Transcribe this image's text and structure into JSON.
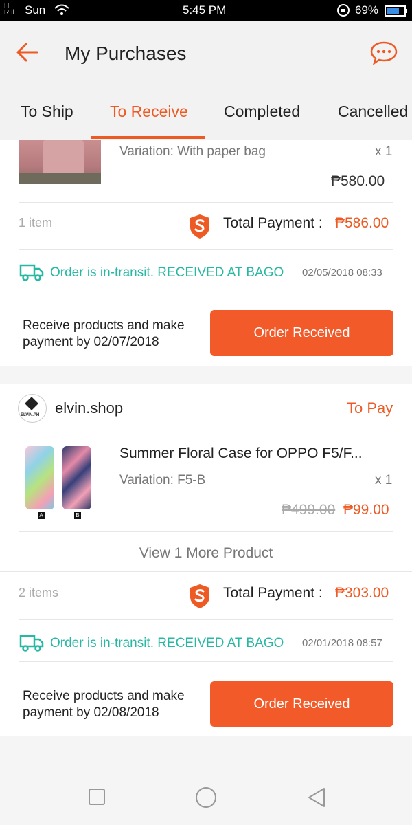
{
  "status_bar": {
    "carrier": "Sun",
    "time": "5:45 PM",
    "battery": "69%"
  },
  "header": {
    "title": "My Purchases",
    "tabs": [
      {
        "label": "To Ship"
      },
      {
        "label": "To Receive"
      },
      {
        "label": "Completed"
      },
      {
        "label": "Cancelled"
      }
    ],
    "active_tab": "To Receive"
  },
  "order1": {
    "variation": "Variation: With paper bag",
    "qty": "x 1",
    "price": "₱580.00",
    "items_count": "1 item",
    "total_label": "Total Payment :",
    "total_value": "₱586.00",
    "status_text": "Order is in-transit. RECEIVED AT BAGO",
    "status_time": "02/05/2018 08:33",
    "receive_text_line1": "Receive products and make",
    "receive_text_line2": "payment by 02/07/2018",
    "button_label": "Order Received"
  },
  "order2": {
    "shop_name": "elvin.shop",
    "shop_logo_text": "ELVIN.PH",
    "status": "To Pay",
    "product_name": "Summer Floral Case for  OPPO F5/F...",
    "variation": "Variation: F5-B",
    "qty": "x 1",
    "original_price": "₱499.00",
    "price": "₱99.00",
    "thumb_labels": [
      "A",
      "B"
    ],
    "view_more": "View 1 More Product",
    "items_count": "2 items",
    "total_label": "Total Payment :",
    "total_value": "₱303.00",
    "status_text": "Order is in-transit. RECEIVED AT BAGO",
    "status_time": "02/01/2018 08:57",
    "receive_text_line1": "Receive products and make",
    "receive_text_line2": "payment by 02/08/2018",
    "button_label": "Order Received"
  },
  "colors": {
    "accent": "#ee5a24",
    "teal": "#27b8a4"
  }
}
